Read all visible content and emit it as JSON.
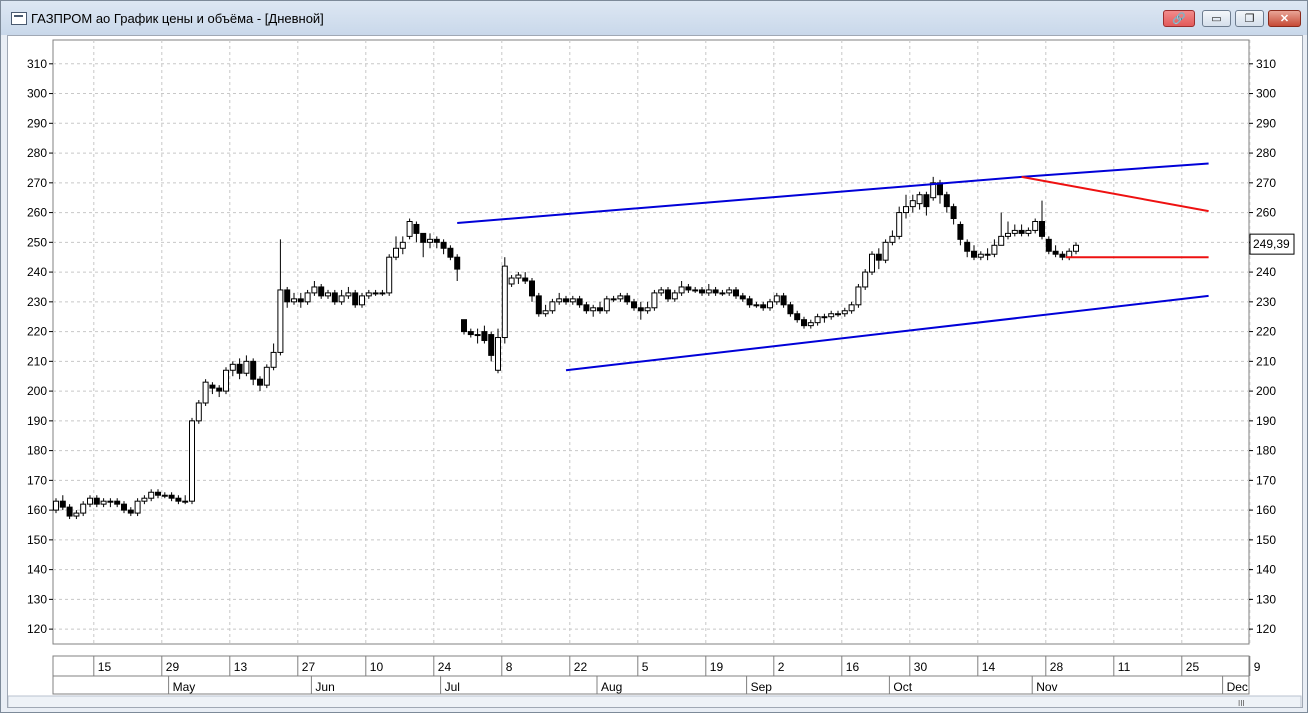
{
  "window": {
    "title": "ГАЗПРОМ ао График цены и объёма - [Дневной]",
    "buttons": {
      "link": "🔗",
      "minimize": "▭",
      "restore": "❐",
      "close": "✕"
    }
  },
  "colors": {
    "channel_line": "#0000d8",
    "triangle_line": "#ee1111",
    "grid": "#c8c8c8",
    "candle": "#000000"
  },
  "chart_data": {
    "type": "candlestick",
    "ylim": [
      115,
      318
    ],
    "y_ticks": [
      120,
      130,
      140,
      150,
      160,
      170,
      180,
      190,
      200,
      210,
      220,
      230,
      240,
      250,
      260,
      270,
      280,
      290,
      300,
      310
    ],
    "last_price_label": "249,39",
    "last_price": 249.39,
    "x_day_labels": [
      {
        "label": "15",
        "i": 6
      },
      {
        "label": "29",
        "i": 16
      },
      {
        "label": "13",
        "i": 26
      },
      {
        "label": "27",
        "i": 36
      },
      {
        "label": "10",
        "i": 46
      },
      {
        "label": "24",
        "i": 56
      },
      {
        "label": "8",
        "i": 66
      },
      {
        "label": "22",
        "i": 76
      },
      {
        "label": "5",
        "i": 86
      },
      {
        "label": "19",
        "i": 96
      },
      {
        "label": "2",
        "i": 106
      },
      {
        "label": "16",
        "i": 116
      },
      {
        "label": "30",
        "i": 126
      },
      {
        "label": "14",
        "i": 136
      },
      {
        "label": "28",
        "i": 146
      },
      {
        "label": "11",
        "i": 156
      },
      {
        "label": "25",
        "i": 166
      },
      {
        "label": "9",
        "i": 176
      }
    ],
    "x_month_labels": [
      {
        "label": "May",
        "i": 17
      },
      {
        "label": "Jun",
        "i": 38
      },
      {
        "label": "Jul",
        "i": 57
      },
      {
        "label": "Aug",
        "i": 80
      },
      {
        "label": "Sep",
        "i": 102
      },
      {
        "label": "Oct",
        "i": 123
      },
      {
        "label": "Nov",
        "i": 144
      },
      {
        "label": "Dec",
        "i": 172
      }
    ],
    "candles": [
      [
        160,
        163,
        164,
        159
      ],
      [
        163,
        161,
        165,
        160
      ],
      [
        161,
        158,
        162,
        157
      ],
      [
        158,
        159,
        160,
        157
      ],
      [
        159,
        162,
        163,
        158
      ],
      [
        162,
        164,
        165,
        161
      ],
      [
        164,
        162,
        165,
        161
      ],
      [
        162,
        163,
        164,
        161
      ],
      [
        163,
        163,
        164,
        161
      ],
      [
        163,
        162,
        164,
        161
      ],
      [
        162,
        160,
        163,
        159
      ],
      [
        160,
        159,
        161,
        158
      ],
      [
        159,
        163,
        164,
        158
      ],
      [
        163,
        164,
        165,
        162
      ],
      [
        164,
        166,
        167,
        163
      ],
      [
        166,
        165,
        167,
        164
      ],
      [
        165,
        165,
        166,
        164
      ],
      [
        165,
        164,
        166,
        163
      ],
      [
        164,
        163,
        165,
        162
      ],
      [
        163,
        163,
        165,
        162
      ],
      [
        163,
        190,
        191,
        162
      ],
      [
        190,
        196,
        197,
        189
      ],
      [
        196,
        203,
        204,
        195
      ],
      [
        202,
        201,
        203,
        199
      ],
      [
        201,
        200,
        202,
        198
      ],
      [
        200,
        207,
        208,
        199
      ],
      [
        207,
        209,
        210,
        205
      ],
      [
        209,
        206,
        211,
        204
      ],
      [
        206,
        210,
        212,
        205
      ],
      [
        210,
        204,
        211,
        202
      ],
      [
        204,
        202,
        205,
        200
      ],
      [
        202,
        208,
        209,
        201
      ],
      [
        208,
        213,
        216,
        207
      ],
      [
        213,
        234,
        251,
        212
      ],
      [
        234,
        230,
        235,
        228
      ],
      [
        230,
        231,
        233,
        229
      ],
      [
        231,
        230,
        233,
        228
      ],
      [
        230,
        233,
        234,
        229
      ],
      [
        233,
        235,
        237,
        232
      ],
      [
        235,
        232,
        236,
        231
      ],
      [
        232,
        233,
        234,
        231
      ],
      [
        233,
        230,
        234,
        229
      ],
      [
        230,
        232,
        234,
        229
      ],
      [
        232,
        233,
        235,
        231
      ],
      [
        233,
        229,
        234,
        228
      ],
      [
        229,
        232,
        233,
        228
      ],
      [
        232,
        233,
        234,
        231
      ],
      [
        233,
        233,
        234,
        232
      ],
      [
        233,
        233,
        234,
        232
      ],
      [
        233,
        245,
        246,
        232
      ],
      [
        245,
        248,
        252,
        244
      ],
      [
        248,
        250,
        252,
        246
      ],
      [
        252,
        257,
        258,
        251
      ],
      [
        256,
        253,
        257,
        250
      ],
      [
        253,
        250,
        253,
        245
      ],
      [
        250,
        251,
        253,
        248
      ],
      [
        251,
        250,
        252,
        248
      ],
      [
        250,
        248,
        251,
        246
      ],
      [
        248,
        245,
        249,
        244
      ],
      [
        245,
        241,
        246,
        237
      ],
      [
        224,
        220,
        224,
        219
      ],
      [
        220,
        219,
        221,
        218
      ],
      [
        219,
        219,
        221,
        216
      ],
      [
        220,
        217,
        222,
        216
      ],
      [
        219,
        212,
        220,
        210
      ],
      [
        207,
        218,
        221,
        206
      ],
      [
        218,
        242,
        245,
        216
      ],
      [
        236,
        238,
        239,
        235
      ],
      [
        238,
        239,
        240,
        236
      ],
      [
        238,
        237,
        240,
        236
      ],
      [
        237,
        232,
        238,
        230
      ],
      [
        232,
        226,
        233,
        225
      ],
      [
        226,
        227,
        229,
        225
      ],
      [
        227,
        230,
        231,
        226
      ],
      [
        230,
        231,
        233,
        229
      ],
      [
        231,
        230,
        232,
        229
      ],
      [
        230,
        231,
        232,
        229
      ],
      [
        231,
        229,
        232,
        228
      ],
      [
        229,
        227,
        230,
        226
      ],
      [
        227,
        228,
        229,
        225
      ],
      [
        228,
        227,
        230,
        226
      ],
      [
        227,
        231,
        232,
        226
      ],
      [
        231,
        231,
        232,
        230
      ],
      [
        231,
        232,
        233,
        230
      ],
      [
        232,
        230,
        233,
        229
      ],
      [
        230,
        228,
        231,
        227
      ],
      [
        228,
        227,
        230,
        224
      ],
      [
        227,
        228,
        230,
        226
      ],
      [
        228,
        233,
        234,
        227
      ],
      [
        233,
        234,
        235,
        232
      ],
      [
        234,
        231,
        235,
        230
      ],
      [
        231,
        233,
        234,
        230
      ],
      [
        233,
        235,
        237,
        232
      ],
      [
        235,
        234,
        236,
        233
      ],
      [
        234,
        234,
        235,
        233
      ],
      [
        234,
        233,
        235,
        232
      ],
      [
        233,
        234,
        236,
        232
      ],
      [
        234,
        233,
        235,
        232
      ],
      [
        233,
        233,
        234,
        232
      ],
      [
        233,
        234,
        235,
        232
      ],
      [
        234,
        232,
        235,
        231
      ],
      [
        232,
        231,
        233,
        230
      ],
      [
        231,
        229,
        232,
        228
      ],
      [
        229,
        229,
        230,
        228
      ],
      [
        229,
        228,
        230,
        227
      ],
      [
        228,
        230,
        231,
        227
      ],
      [
        230,
        232,
        233,
        229
      ],
      [
        232,
        229,
        233,
        228
      ],
      [
        229,
        226,
        230,
        225
      ],
      [
        226,
        224,
        227,
        223
      ],
      [
        224,
        222,
        225,
        221
      ],
      [
        222,
        223,
        224,
        221
      ],
      [
        223,
        225,
        226,
        222
      ],
      [
        225,
        225,
        226,
        223
      ],
      [
        225,
        226,
        227,
        224
      ],
      [
        226,
        226,
        227,
        225
      ],
      [
        226,
        227,
        228,
        225
      ],
      [
        227,
        229,
        230,
        226
      ],
      [
        229,
        235,
        236,
        228
      ],
      [
        235,
        240,
        241,
        234
      ],
      [
        240,
        246,
        247,
        239
      ],
      [
        246,
        244,
        248,
        241
      ],
      [
        244,
        250,
        251,
        243
      ],
      [
        250,
        252,
        254,
        249
      ],
      [
        252,
        260,
        262,
        251
      ],
      [
        260,
        262,
        266,
        258
      ],
      [
        262,
        264,
        266,
        260
      ],
      [
        263,
        266,
        267,
        261
      ],
      [
        266,
        262,
        267,
        259
      ],
      [
        265,
        270,
        272,
        264
      ],
      [
        270,
        266,
        271,
        263
      ],
      [
        266,
        262,
        267,
        260
      ],
      [
        262,
        258,
        263,
        256
      ],
      [
        256,
        251,
        257,
        249
      ],
      [
        250,
        247,
        251,
        245
      ],
      [
        247,
        245,
        249,
        244
      ],
      [
        245,
        246,
        247,
        244
      ],
      [
        246,
        246,
        248,
        244
      ],
      [
        246,
        249,
        251,
        245
      ],
      [
        249,
        252,
        260,
        249
      ],
      [
        252,
        253,
        257,
        251
      ],
      [
        253,
        254,
        256,
        252
      ],
      [
        254,
        253,
        256,
        252
      ],
      [
        253,
        254,
        255,
        252
      ],
      [
        254,
        257,
        258,
        253
      ],
      [
        257,
        252,
        264,
        251
      ],
      [
        251,
        247,
        252,
        246
      ],
      [
        247,
        246,
        249,
        245
      ],
      [
        246,
        245,
        247,
        244
      ],
      [
        245,
        247,
        248,
        244
      ],
      [
        247,
        249,
        250,
        246
      ]
    ],
    "trendlines": [
      {
        "name": "channel-top",
        "color": "#0000d8",
        "points": [
          [
            59,
            256.5
          ],
          [
            142,
            272
          ],
          [
            169.5,
            276.5
          ]
        ]
      },
      {
        "name": "channel-bottom",
        "color": "#0000d8",
        "points": [
          [
            75,
            207
          ],
          [
            169.5,
            232
          ]
        ]
      },
      {
        "name": "triangle-top",
        "color": "#ee1111",
        "points": [
          [
            142,
            272
          ],
          [
            169.5,
            260.5
          ]
        ]
      },
      {
        "name": "triangle-bottom",
        "color": "#ee1111",
        "points": [
          [
            148.5,
            245
          ],
          [
            169.5,
            245
          ]
        ]
      }
    ],
    "grid": true
  }
}
